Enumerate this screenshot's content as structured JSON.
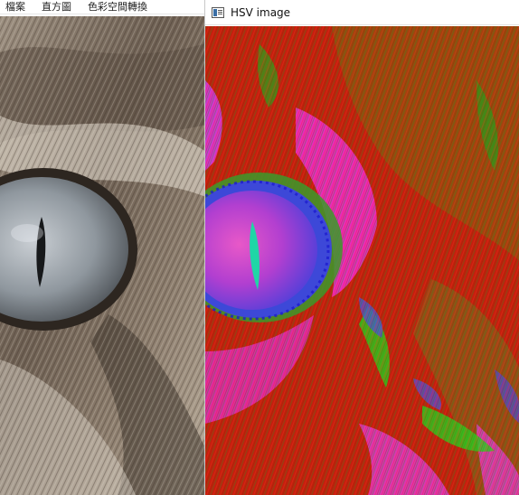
{
  "left_window": {
    "menu": [
      "檔案",
      "直方圖",
      "色彩空間轉換"
    ]
  },
  "right_window": {
    "title": "HSV image"
  }
}
